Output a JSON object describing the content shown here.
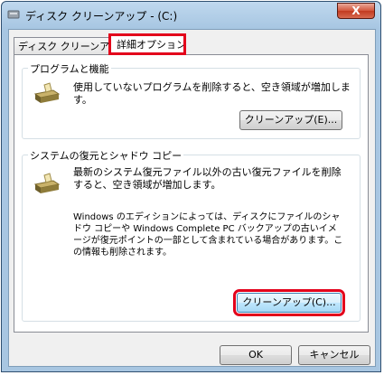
{
  "window": {
    "title": "ディスク クリーンアップ - (C:)",
    "close_label": "X"
  },
  "tabs": [
    {
      "label": "ディスク クリーンアップ"
    },
    {
      "label": "詳細オプション"
    }
  ],
  "groups": [
    {
      "legend": "プログラムと機能",
      "description": "使用していないプログラムを削除すると、空き領域が増加します。",
      "button": "クリーンアップ(E)..."
    },
    {
      "legend": "システムの復元とシャドウ コピー",
      "description": "最新のシステム復元ファイル以外の古い復元ファイルを削除すると、空き領域が増加します。",
      "note": "Windows のエディションによっては、ディスクにファイルのシャドウ コピーや Windows Complete PC バックアップの古いイメージが復元ポイントの一部として含まれている場合があります。この情報も削除されます。",
      "button": "クリーンアップ(C)..."
    }
  ],
  "footer": {
    "ok": "OK",
    "cancel": "キャンセル"
  },
  "colors": {
    "highlight": "#e3001b",
    "titlebar": "#a8c6e1"
  }
}
